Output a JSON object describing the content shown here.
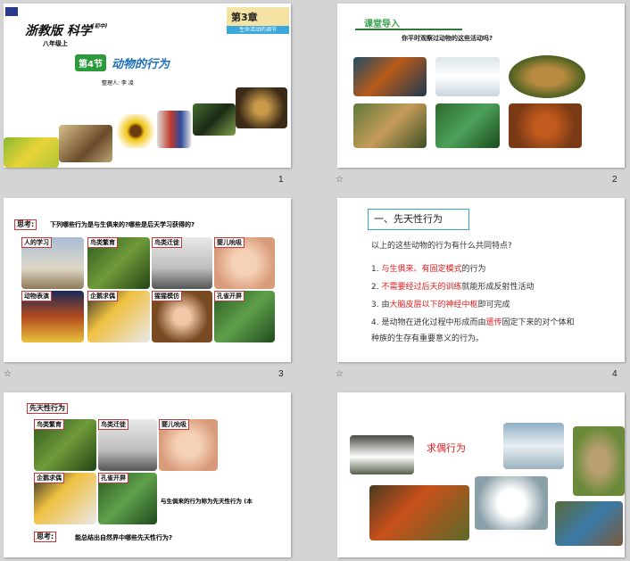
{
  "slides": [
    {
      "num": "1",
      "book_title": "浙教版 科学",
      "book_sub": "(初中)",
      "grade": "八年级上",
      "chapter_badge": "第3章",
      "chapter_sub": "生命活动的调节",
      "section": "第4节",
      "section_title": "动物的行为",
      "author": "整理人: 李 凌"
    },
    {
      "num": "2",
      "heading": "课堂导入",
      "question": "你平时观察过动物的这些活动吗?"
    },
    {
      "num": "3",
      "think_label": "思考:",
      "question": "下列哪些行为是与生俱来的?哪些是后天学习获得的?",
      "labels": [
        "人的学习",
        "鸟类繁育",
        "鸟类迁徙",
        "婴儿吮吸",
        "动物表演",
        "企鹅求偶",
        "猩猩模仿",
        "孔雀开屏"
      ]
    },
    {
      "num": "4",
      "heading": "一、先天性行为",
      "intro": "以上的这些动物的行为有什么共同特点?",
      "items": [
        {
          "n": "1.",
          "red": "与生俱来、有固定模式",
          "rest": "的行为"
        },
        {
          "n": "2.",
          "red": "不需要经过后天的训练",
          "rest": "就能形成反射性活动"
        },
        {
          "n": "3.",
          "pre": "由",
          "red": "大脑皮层以下的神经中枢",
          "rest": "即可完成"
        },
        {
          "n": "4.",
          "pre": "是动物在进化过程中形成而由",
          "red": "遗传",
          "rest": "固定下来的对个体和"
        }
      ],
      "tail": "种族的生存有重要意义的行为。"
    },
    {
      "num": "",
      "title_label": "先天性行为",
      "labels": [
        "鸟类繁育",
        "鸟类迁徙",
        "婴儿吮吸",
        "企鹅求偶",
        "孔雀开屏"
      ],
      "caption": "与生俱来的行为称为先天性行为 (本",
      "think_label": "思考:",
      "question": "能总结出自然界中哪些先天性行为?"
    },
    {
      "num": "",
      "label": "求偶行为"
    }
  ]
}
